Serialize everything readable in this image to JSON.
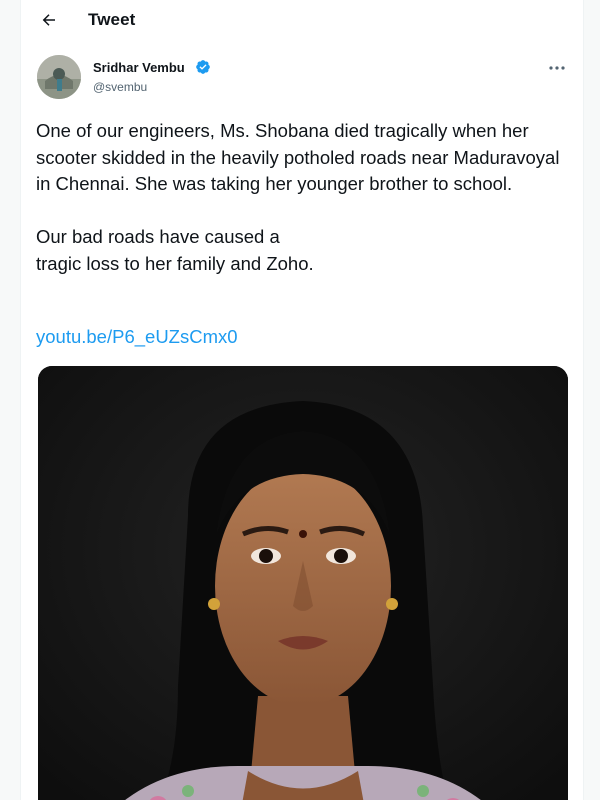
{
  "header": {
    "title": "Tweet",
    "back_icon": "arrow-left-icon"
  },
  "author": {
    "name": "Sridhar Vembu",
    "handle": "@svembu",
    "verified": true,
    "verified_color": "#1d9bf0"
  },
  "tweet": {
    "paragraphs": [
      "One of our engineers, Ms. Shobana died tragically when her scooter skidded in the heavily potholed roads near Maduravoyal in Chennai. She was taking her younger brother to school.",
      "Our bad roads have caused a tragic loss to her family and Zoho."
    ],
    "paragraph_2_lines": [
      "Our bad roads have caused a",
      "tragic loss to her family and Zoho."
    ],
    "link": "youtu.be/P6_eUZsCmx0"
  },
  "colors": {
    "text": "#0f1419",
    "secondary": "#536471",
    "link": "#1d9bf0"
  },
  "icons": {
    "more": "more-dots-icon",
    "verified": "verified-badge-icon"
  }
}
